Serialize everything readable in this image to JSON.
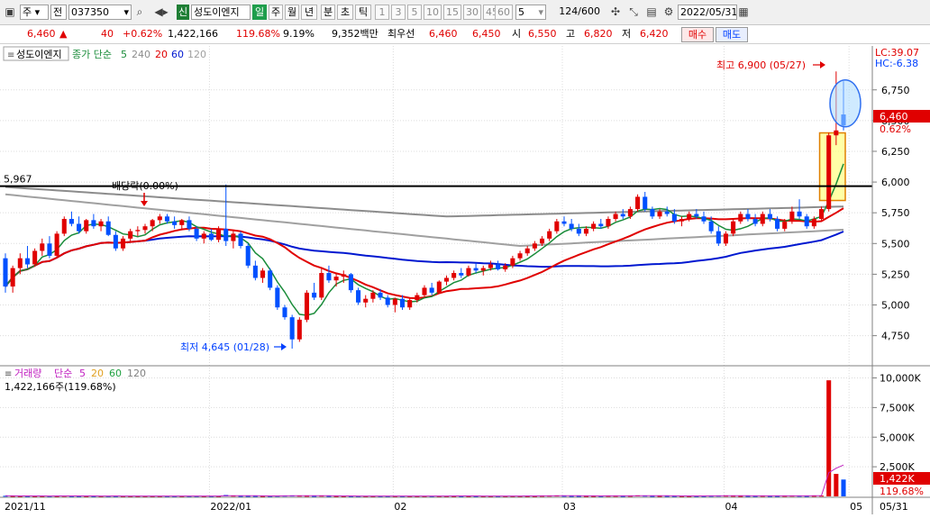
{
  "toolbar": {
    "market_label": "주",
    "type_label": "전",
    "code": "037350",
    "period_badge": "신",
    "stock_name": "성도이엔지",
    "period_buttons": [
      "일",
      "주",
      "월",
      "년",
      "분",
      "초",
      "틱"
    ],
    "minute_buttons": [
      "1",
      "3",
      "5",
      "10",
      "15",
      "30",
      "45",
      "60"
    ],
    "interval_value": "5",
    "count_value": "124",
    "count_total": "/600",
    "date_value": "2022/05/31"
  },
  "quote": {
    "price": "6,460",
    "arrow": "▲",
    "change": "40",
    "change_pct": "+0.62%",
    "volume": "1,422,166",
    "volume_ratio": "119.68%",
    "turnover": "9.19%",
    "amount": "9,352백만",
    "best_label": "최우선",
    "ask": "6,460",
    "bid": "6,450",
    "open_label": "시",
    "open": "6,550",
    "high_label": "고",
    "high": "6,820",
    "low_label": "저",
    "low": "6,420",
    "buy_label": "매수",
    "sell_label": "매도"
  },
  "legend": {
    "stock_tag": "성도이엔지",
    "price_ma_label": "종가 단순",
    "price_ma_periods": [
      "5",
      "240",
      "20",
      "60",
      "120"
    ],
    "volume_label": "거래량",
    "volume_ma_label": "단순",
    "volume_ma_periods": [
      "5",
      "20",
      "60",
      "120"
    ],
    "volume_note": "1,422,166주(119.68%)"
  },
  "colors": {
    "up": "#e00000",
    "down": "#0050ff",
    "ma5": "#1a8c3a",
    "ma240": "#8c8c8c",
    "ma20": "#e00000",
    "ma60": "#0018d0",
    "ma120": "#a0a0a0",
    "vol_ma5": "#c020c0",
    "vol_ma20": "#e0a020",
    "vol_ma60": "#20a040",
    "highlight_box": "#e08000",
    "highlight_fill": "#ffff80",
    "ellipse": "#3070f0",
    "hline": "#000000"
  },
  "annotations": {
    "hline_label": "5,967",
    "dividend_label": "배당락(0.00%)",
    "high_label": "최고 6,900 (05/27)",
    "low_label": "최저 4,645 (01/28)",
    "lc": "LC:39.07",
    "hc": "HC:-6.38",
    "last_price_tag": "6,460",
    "last_pct_tag": "0.62%",
    "vol_tag": "1,422K",
    "vol_pct_tag": "119.68%"
  },
  "price_axis": {
    "ticks": [
      "6,750",
      "6,500",
      "6,250",
      "6,000",
      "5,750",
      "5,500",
      "5,250",
      "5,000",
      "4,750"
    ],
    "values": [
      6750,
      6500,
      6250,
      6000,
      5750,
      5500,
      5250,
      5000,
      4750
    ],
    "min": 4520,
    "max": 7100
  },
  "volume_axis": {
    "ticks": [
      "10,000K",
      "7,500K",
      "5,000K",
      "2,500K"
    ],
    "values": [
      10000,
      7500,
      5000,
      2500
    ],
    "max": 10800
  },
  "date_axis": {
    "labels": [
      "2021/11",
      "2022/01",
      "02",
      "03",
      "04",
      "05",
      "05/31"
    ]
  },
  "chart_data": {
    "type": "candlestick",
    "title": "",
    "xlabel": "",
    "ylabel": "",
    "x_labels": [
      "2021/11",
      "2022/01",
      "02",
      "03",
      "04",
      "05",
      "05/31"
    ],
    "price_range": [
      4520,
      7100
    ],
    "ohlc_estimated": [
      [
        5380,
        5420,
        5100,
        5150
      ],
      [
        5150,
        5320,
        5100,
        5300
      ],
      [
        5300,
        5420,
        5250,
        5380
      ],
      [
        5380,
        5480,
        5300,
        5330
      ],
      [
        5330,
        5460,
        5310,
        5440
      ],
      [
        5440,
        5540,
        5400,
        5500
      ],
      [
        5500,
        5560,
        5380,
        5400
      ],
      [
        5400,
        5600,
        5380,
        5580
      ],
      [
        5580,
        5720,
        5560,
        5700
      ],
      [
        5700,
        5760,
        5640,
        5660
      ],
      [
        5660,
        5720,
        5580,
        5600
      ],
      [
        5600,
        5700,
        5580,
        5690
      ],
      [
        5690,
        5740,
        5620,
        5640
      ],
      [
        5640,
        5700,
        5600,
        5680
      ],
      [
        5680,
        5720,
        5560,
        5570
      ],
      [
        5570,
        5600,
        5440,
        5460
      ],
      [
        5460,
        5560,
        5440,
        5540
      ],
      [
        5540,
        5620,
        5520,
        5600
      ],
      [
        5600,
        5640,
        5560,
        5610
      ],
      [
        5610,
        5660,
        5580,
        5640
      ],
      [
        5640,
        5700,
        5600,
        5690
      ],
      [
        5690,
        5740,
        5660,
        5720
      ],
      [
        5720,
        5740,
        5660,
        5680
      ],
      [
        5680,
        5720,
        5620,
        5650
      ],
      [
        5650,
        5700,
        5620,
        5690
      ],
      [
        5690,
        5720,
        5600,
        5620
      ],
      [
        5620,
        5640,
        5520,
        5540
      ],
      [
        5540,
        5600,
        5500,
        5580
      ],
      [
        5580,
        5620,
        5520,
        5530
      ],
      [
        5530,
        5640,
        5510,
        5620
      ],
      [
        5620,
        5980,
        5480,
        5520
      ],
      [
        5520,
        5600,
        5460,
        5580
      ],
      [
        5580,
        5600,
        5460,
        5480
      ],
      [
        5480,
        5500,
        5300,
        5320
      ],
      [
        5320,
        5360,
        5200,
        5220
      ],
      [
        5220,
        5300,
        5180,
        5280
      ],
      [
        5280,
        5300,
        5120,
        5140
      ],
      [
        5140,
        5160,
        4960,
        4980
      ],
      [
        4980,
        5000,
        4880,
        4900
      ],
      [
        4900,
        4920,
        4645,
        4720
      ],
      [
        4720,
        4900,
        4700,
        4880
      ],
      [
        4880,
        5120,
        4860,
        5100
      ],
      [
        5100,
        5180,
        5040,
        5060
      ],
      [
        5060,
        5300,
        5040,
        5260
      ],
      [
        5260,
        5320,
        5180,
        5200
      ],
      [
        5200,
        5260,
        5150,
        5230
      ],
      [
        5230,
        5280,
        5180,
        5250
      ],
      [
        5250,
        5260,
        5100,
        5120
      ],
      [
        5120,
        5140,
        5000,
        5020
      ],
      [
        5020,
        5080,
        4980,
        5050
      ],
      [
        5050,
        5120,
        5020,
        5100
      ],
      [
        5100,
        5130,
        5040,
        5060
      ],
      [
        5060,
        5080,
        4980,
        5000
      ],
      [
        5000,
        5060,
        4940,
        5050
      ],
      [
        5050,
        5080,
        4960,
        4980
      ],
      [
        4980,
        5060,
        4960,
        5040
      ],
      [
        5040,
        5100,
        5020,
        5080
      ],
      [
        5080,
        5160,
        5060,
        5140
      ],
      [
        5140,
        5180,
        5080,
        5100
      ],
      [
        5100,
        5200,
        5090,
        5190
      ],
      [
        5190,
        5240,
        5160,
        5220
      ],
      [
        5220,
        5280,
        5200,
        5260
      ],
      [
        5260,
        5300,
        5220,
        5240
      ],
      [
        5240,
        5320,
        5230,
        5300
      ],
      [
        5300,
        5340,
        5260,
        5280
      ],
      [
        5280,
        5320,
        5240,
        5300
      ],
      [
        5300,
        5360,
        5280,
        5330
      ],
      [
        5330,
        5360,
        5280,
        5290
      ],
      [
        5290,
        5340,
        5270,
        5320
      ],
      [
        5320,
        5400,
        5300,
        5380
      ],
      [
        5380,
        5440,
        5360,
        5420
      ],
      [
        5420,
        5480,
        5400,
        5460
      ],
      [
        5460,
        5520,
        5440,
        5500
      ],
      [
        5500,
        5560,
        5480,
        5540
      ],
      [
        5540,
        5620,
        5520,
        5600
      ],
      [
        5600,
        5700,
        5580,
        5680
      ],
      [
        5680,
        5720,
        5640,
        5660
      ],
      [
        5660,
        5700,
        5600,
        5620
      ],
      [
        5620,
        5660,
        5560,
        5580
      ],
      [
        5580,
        5640,
        5560,
        5620
      ],
      [
        5620,
        5680,
        5600,
        5660
      ],
      [
        5660,
        5700,
        5620,
        5640
      ],
      [
        5640,
        5720,
        5620,
        5700
      ],
      [
        5700,
        5760,
        5680,
        5740
      ],
      [
        5740,
        5780,
        5700,
        5720
      ],
      [
        5720,
        5800,
        5700,
        5780
      ],
      [
        5780,
        5900,
        5760,
        5880
      ],
      [
        5880,
        5920,
        5760,
        5780
      ],
      [
        5780,
        5800,
        5700,
        5720
      ],
      [
        5720,
        5780,
        5700,
        5760
      ],
      [
        5760,
        5800,
        5720,
        5740
      ],
      [
        5740,
        5780,
        5660,
        5680
      ],
      [
        5680,
        5720,
        5640,
        5700
      ],
      [
        5700,
        5760,
        5680,
        5740
      ],
      [
        5740,
        5780,
        5700,
        5720
      ],
      [
        5720,
        5760,
        5660,
        5680
      ],
      [
        5680,
        5720,
        5580,
        5600
      ],
      [
        5600,
        5640,
        5480,
        5500
      ],
      [
        5500,
        5600,
        5480,
        5580
      ],
      [
        5580,
        5700,
        5560,
        5680
      ],
      [
        5680,
        5760,
        5660,
        5740
      ],
      [
        5740,
        5780,
        5680,
        5700
      ],
      [
        5700,
        5740,
        5640,
        5660
      ],
      [
        5660,
        5760,
        5640,
        5740
      ],
      [
        5740,
        5780,
        5680,
        5700
      ],
      [
        5700,
        5720,
        5600,
        5620
      ],
      [
        5620,
        5700,
        5600,
        5680
      ],
      [
        5680,
        5800,
        5660,
        5760
      ],
      [
        5760,
        5860,
        5700,
        5720
      ],
      [
        5720,
        5740,
        5620,
        5640
      ],
      [
        5640,
        5720,
        5620,
        5700
      ],
      [
        5700,
        5800,
        5680,
        5780
      ],
      [
        5780,
        6400,
        5760,
        6380
      ],
      [
        6380,
        6900,
        6300,
        6420
      ],
      [
        6550,
        6820,
        6420,
        6460
      ]
    ],
    "volume_k_estimated": [
      50,
      40,
      30,
      40,
      30,
      40,
      30,
      40,
      50,
      40,
      30,
      40,
      30,
      30,
      40,
      40,
      30,
      30,
      30,
      30,
      30,
      30,
      30,
      30,
      30,
      30,
      40,
      30,
      30,
      30,
      120,
      60,
      40,
      40,
      40,
      30,
      40,
      50,
      60,
      70,
      60,
      50,
      40,
      60,
      40,
      30,
      30,
      30,
      30,
      30,
      30,
      30,
      30,
      30,
      30,
      30,
      30,
      30,
      30,
      40,
      40,
      40,
      30,
      40,
      30,
      30,
      30,
      30,
      30,
      40,
      40,
      40,
      40,
      50,
      60,
      70,
      50,
      40,
      40,
      40,
      40,
      40,
      50,
      50,
      40,
      50,
      80,
      60,
      40,
      40,
      40,
      40,
      40,
      40,
      40,
      40,
      50,
      60,
      60,
      50,
      40,
      40,
      40,
      50,
      40,
      40,
      50,
      60,
      50,
      40,
      50,
      60,
      9800,
      1900,
      1422
    ]
  }
}
